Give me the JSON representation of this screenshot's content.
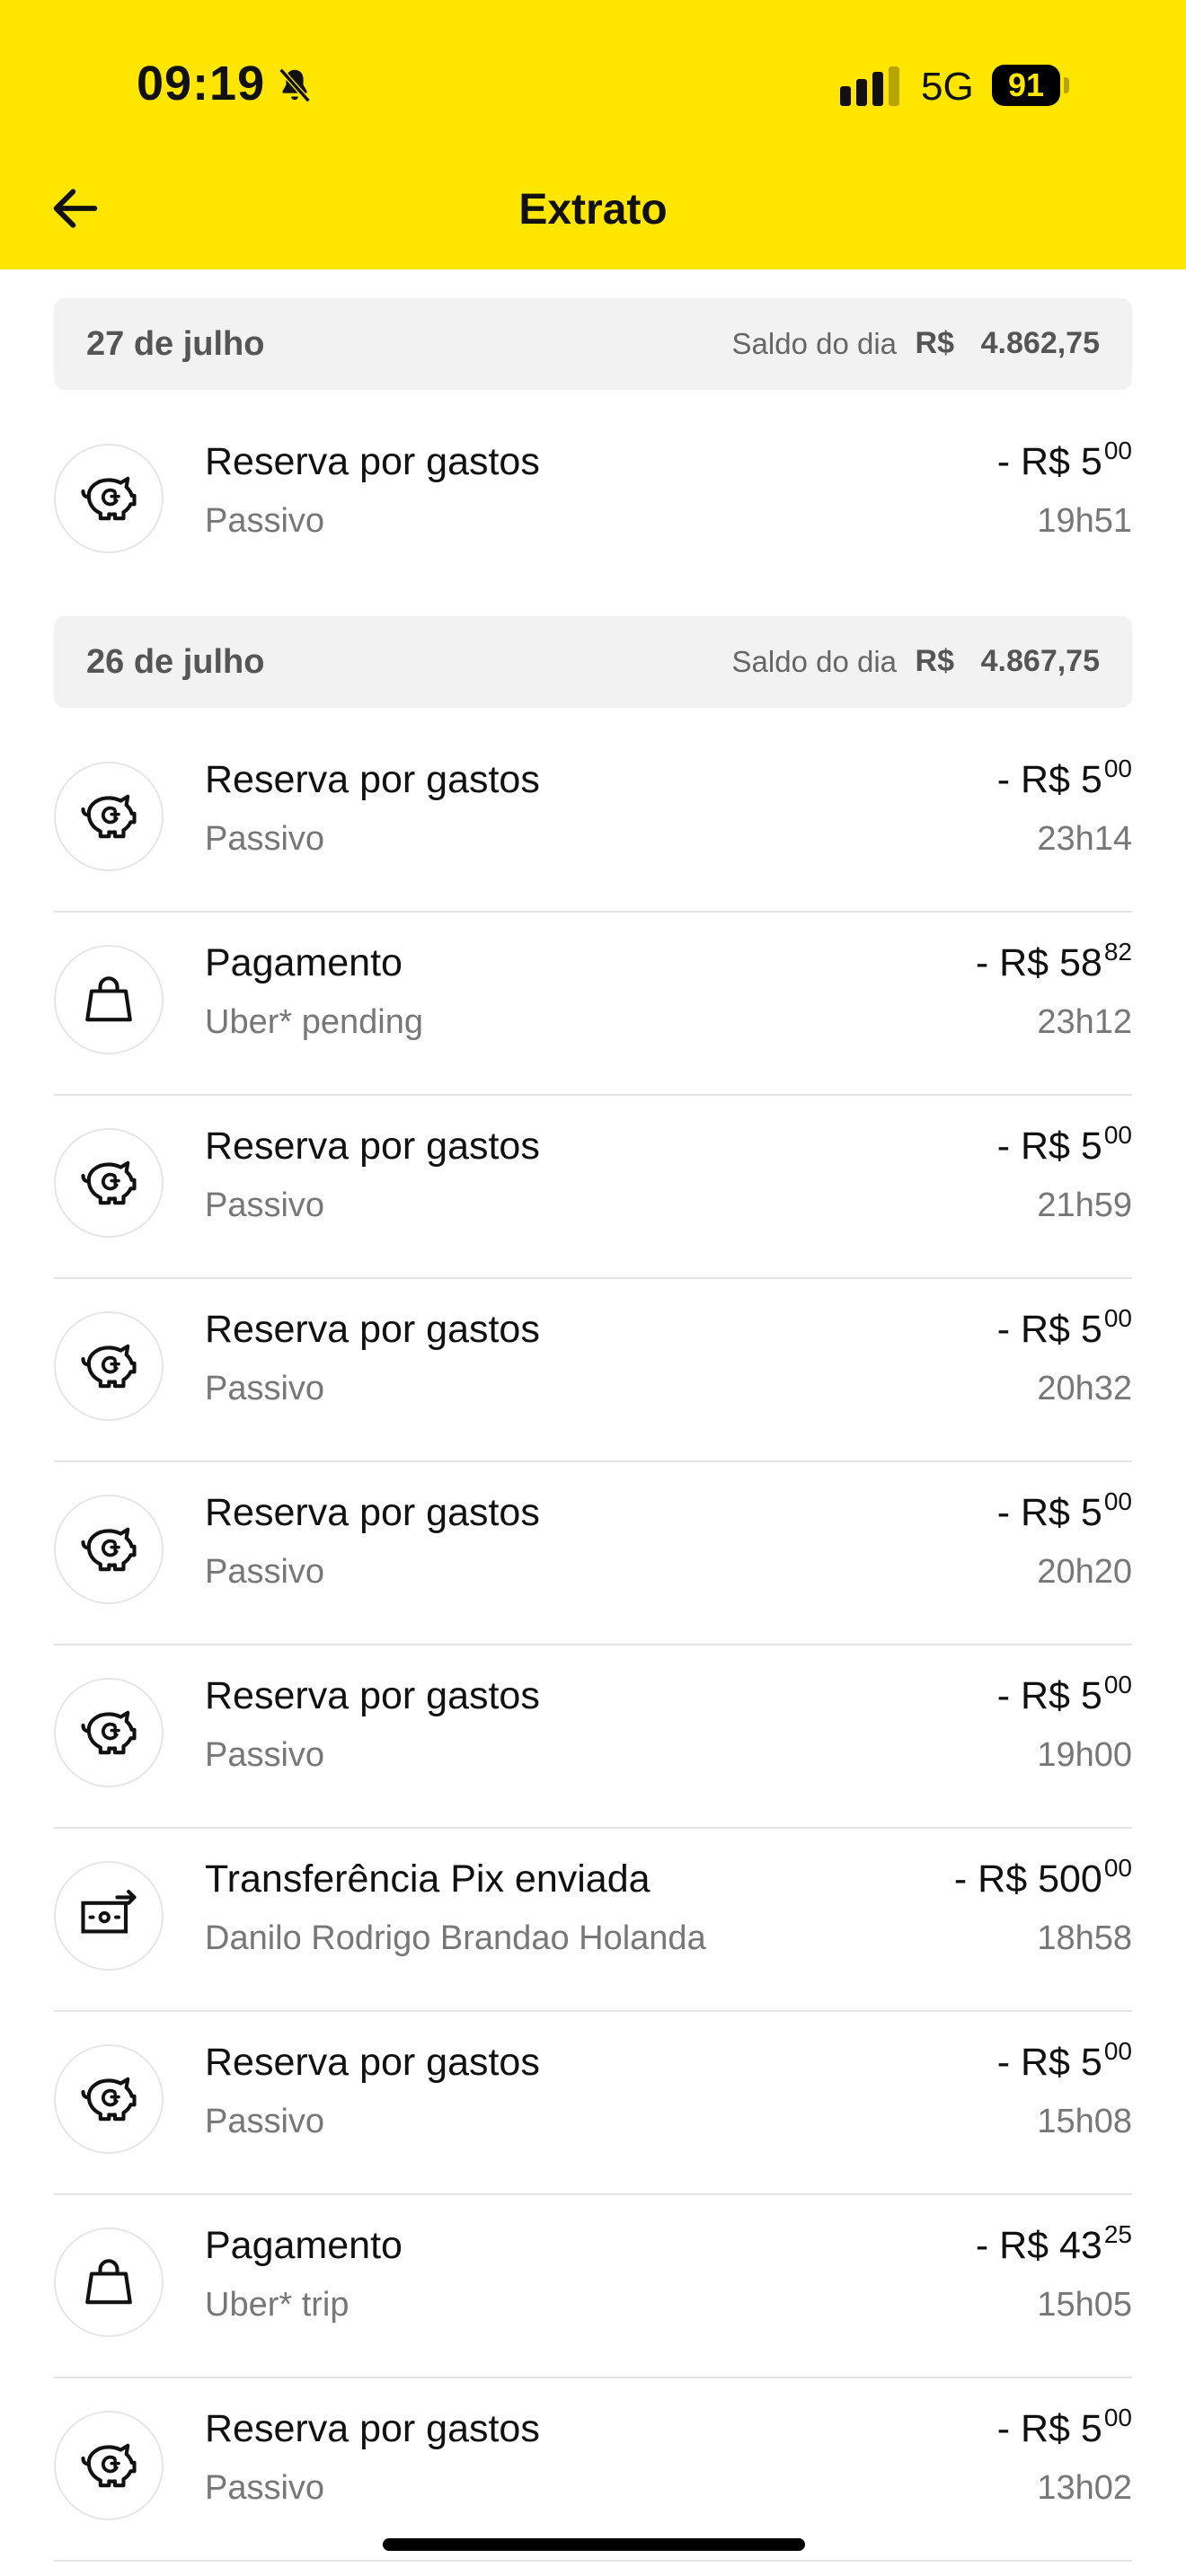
{
  "status_bar": {
    "time": "09:19",
    "network": "5G",
    "battery": "91"
  },
  "header": {
    "title": "Extrato"
  },
  "days": [
    {
      "date": "27 de julho",
      "balance_label": "Saldo do dia",
      "currency": "R$",
      "balance": "4.862,75"
    },
    {
      "date": "26 de julho",
      "balance_label": "Saldo do dia",
      "currency": "R$",
      "balance": "4.867,75"
    }
  ],
  "transactions": [
    {
      "icon": "piggy-bank-icon",
      "title": "Reserva por gastos",
      "subtitle": "Passivo",
      "amount_main": "- R$ 5",
      "amount_cents": "00",
      "time": "19h51"
    },
    {
      "icon": "piggy-bank-icon",
      "title": "Reserva por gastos",
      "subtitle": "Passivo",
      "amount_main": "- R$ 5",
      "amount_cents": "00",
      "time": "23h14"
    },
    {
      "icon": "shopping-bag-icon",
      "title": "Pagamento",
      "subtitle": "Uber* pending",
      "amount_main": "- R$ 58",
      "amount_cents": "82",
      "time": "23h12"
    },
    {
      "icon": "piggy-bank-icon",
      "title": "Reserva por gastos",
      "subtitle": "Passivo",
      "amount_main": "- R$ 5",
      "amount_cents": "00",
      "time": "21h59"
    },
    {
      "icon": "piggy-bank-icon",
      "title": "Reserva por gastos",
      "subtitle": "Passivo",
      "amount_main": "- R$ 5",
      "amount_cents": "00",
      "time": "20h32"
    },
    {
      "icon": "piggy-bank-icon",
      "title": "Reserva por gastos",
      "subtitle": "Passivo",
      "amount_main": "- R$ 5",
      "amount_cents": "00",
      "time": "20h20"
    },
    {
      "icon": "piggy-bank-icon",
      "title": "Reserva por gastos",
      "subtitle": "Passivo",
      "amount_main": "- R$ 5",
      "amount_cents": "00",
      "time": "19h00"
    },
    {
      "icon": "money-transfer-icon",
      "title": "Transferência Pix enviada",
      "subtitle": "Danilo Rodrigo Brandao Holanda",
      "amount_main": "- R$ 500",
      "amount_cents": "00",
      "time": "18h58"
    },
    {
      "icon": "piggy-bank-icon",
      "title": "Reserva por gastos",
      "subtitle": "Passivo",
      "amount_main": "- R$ 5",
      "amount_cents": "00",
      "time": "15h08"
    },
    {
      "icon": "shopping-bag-icon",
      "title": "Pagamento",
      "subtitle": "Uber* trip",
      "amount_main": "- R$ 43",
      "amount_cents": "25",
      "time": "15h05"
    },
    {
      "icon": "piggy-bank-icon",
      "title": "Reserva por gastos",
      "subtitle": "Passivo",
      "amount_main": "- R$ 5",
      "amount_cents": "00",
      "time": "13h02"
    }
  ]
}
